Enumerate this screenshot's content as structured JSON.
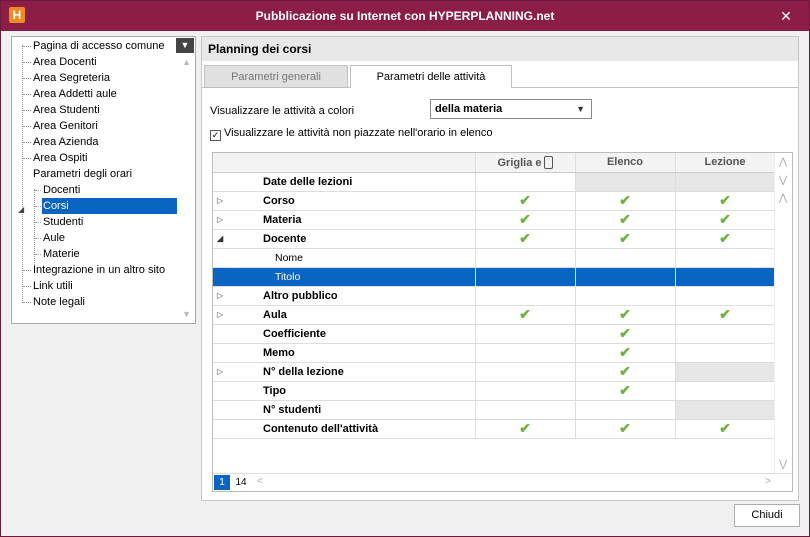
{
  "window": {
    "title": "Pubblicazione su Internet con HYPERPLANNING.net",
    "app_icon_letter": "H",
    "close_glyph": "✕"
  },
  "tree": {
    "items": [
      {
        "label": "Pagina di accesso comune",
        "level": 0
      },
      {
        "label": "Area Docenti",
        "level": 0
      },
      {
        "label": "Area Segreteria",
        "level": 0
      },
      {
        "label": "Area Addetti aule",
        "level": 0
      },
      {
        "label": "Area Studenti",
        "level": 0
      },
      {
        "label": "Area Genitori",
        "level": 0
      },
      {
        "label": "Area Azienda",
        "level": 0
      },
      {
        "label": "Area Ospiti",
        "level": 0
      },
      {
        "label": "Parametri degli orari",
        "level": 0
      },
      {
        "label": "Docenti",
        "level": 1
      },
      {
        "label": "Corsi",
        "level": 1,
        "selected": true
      },
      {
        "label": "Studenti",
        "level": 1
      },
      {
        "label": "Aule",
        "level": 1
      },
      {
        "label": "Materie",
        "level": 1
      },
      {
        "label": "Integrazione in un altro sito",
        "level": 0
      },
      {
        "label": "Link utili",
        "level": 0
      },
      {
        "label": "Note legali",
        "level": 0
      }
    ]
  },
  "panel": {
    "title": "Planning dei corsi",
    "tabs": [
      {
        "label": "Parametri generali"
      },
      {
        "label": "Parametri delle attività"
      }
    ],
    "color_label": "Visualizzare le attività a colori",
    "color_value": "della materia",
    "check_label": "Visualizzare le attività non piazzate nell'orario in elenco"
  },
  "grid": {
    "columns": [
      "Griglia e",
      "Elenco",
      "Lezione"
    ],
    "rows": [
      {
        "label": "Date delle lezioni",
        "expander": "",
        "cells": [
          "",
          "gray",
          "gray"
        ]
      },
      {
        "label": "Corso",
        "expander": "closed",
        "cells": [
          "check",
          "check",
          "check"
        ]
      },
      {
        "label": "Materia",
        "expander": "closed",
        "cells": [
          "check",
          "check",
          "check"
        ]
      },
      {
        "label": "Docente",
        "expander": "open",
        "cells": [
          "check",
          "check",
          "check"
        ]
      },
      {
        "label": "Nome",
        "expander": "",
        "child": true,
        "cells": [
          "",
          "",
          ""
        ]
      },
      {
        "label": "Titolo",
        "expander": "",
        "child": true,
        "selected": true,
        "cells": [
          "",
          "",
          ""
        ]
      },
      {
        "label": "Altro pubblico",
        "expander": "closed",
        "cells": [
          "",
          "",
          ""
        ]
      },
      {
        "label": "Aula",
        "expander": "closed",
        "cells": [
          "check",
          "check",
          "check"
        ]
      },
      {
        "label": "Coefficiente",
        "expander": "",
        "cells": [
          "",
          "check",
          ""
        ]
      },
      {
        "label": "Memo",
        "expander": "",
        "cells": [
          "",
          "check",
          ""
        ]
      },
      {
        "label": "N° della lezione",
        "expander": "closed",
        "cells": [
          "",
          "check",
          "gray"
        ]
      },
      {
        "label": "Tipo",
        "expander": "",
        "cells": [
          "",
          "check",
          ""
        ]
      },
      {
        "label": "N° studenti",
        "expander": "",
        "cells": [
          "",
          "",
          "gray"
        ]
      },
      {
        "label": "Contenuto dell'attività",
        "expander": "",
        "cells": [
          "check",
          "check",
          "check"
        ]
      }
    ],
    "pager": {
      "current": "1",
      "other": "14"
    }
  },
  "footer": {
    "close_label": "Chiudi"
  },
  "colors": {
    "titlebar": "#8b1d47",
    "selection": "#0a64c2",
    "check": "#6db33f"
  }
}
